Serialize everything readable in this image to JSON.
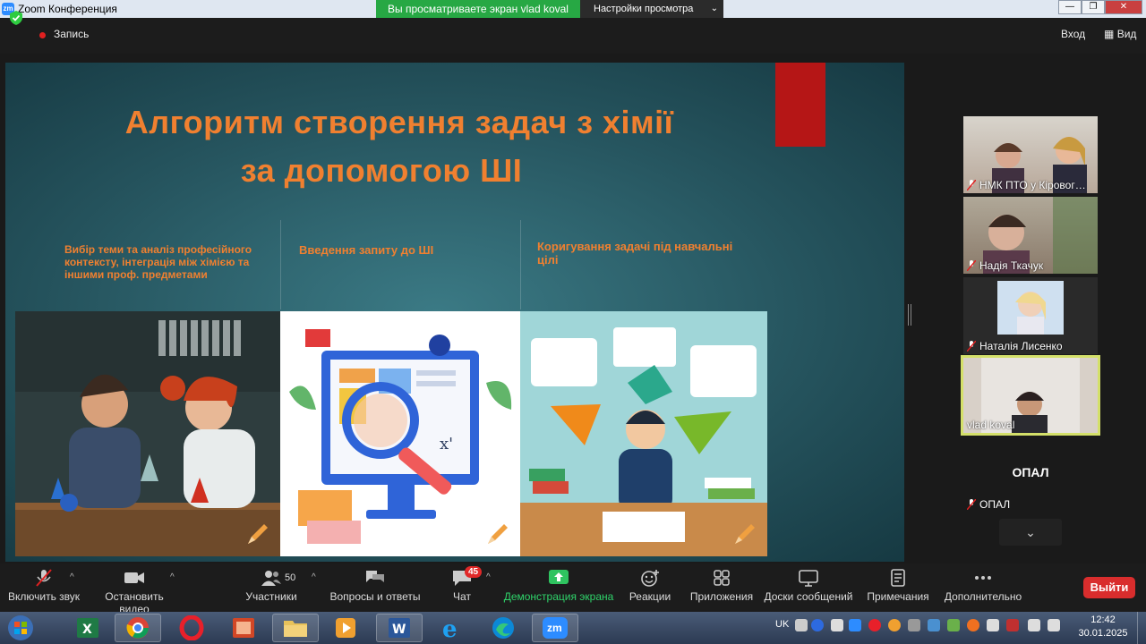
{
  "window": {
    "app_logo": "zm",
    "title": "Zoom Конференция",
    "share_banner": "Вы просматриваете экран vlad koval",
    "view_settings": "Настройки просмотра"
  },
  "status": {
    "recording_label": "Запись",
    "enter_label": "Вход",
    "view_label": "Вид"
  },
  "slide": {
    "title_line1": "Алгоритм створення задач з хімії",
    "title_line2": "за допомогою ШІ",
    "captions": [
      "Вибір теми та аналіз професійного контексту, інтеграція між хімією та іншими проф. предметами",
      "Введення запиту до ШІ",
      "Коригування задачі під навчальні цілі"
    ]
  },
  "gallery": {
    "participants": [
      {
        "name": "НМК ПТО у Кіровог…",
        "muted": true
      },
      {
        "name": "Надія Ткачук",
        "muted": true
      },
      {
        "name": "Наталія Лисенко",
        "muted": true
      },
      {
        "name": "vlad koval",
        "muted": false,
        "active": true
      },
      {
        "name": "ОПАЛ",
        "muted": true,
        "big_label": "ОПАЛ"
      }
    ],
    "scroll_icon": "chevron-down-icon"
  },
  "toolbar": {
    "unmute": "Включить звук",
    "stop_video": "Остановить видео",
    "participants": "Участники",
    "participants_count": "50",
    "qa": "Вопросы и ответы",
    "chat": "Чат",
    "chat_badge": "45",
    "share": "Демонстрация экрана",
    "reactions": "Реакции",
    "apps": "Приложения",
    "whiteboards": "Доски сообщений",
    "notes": "Примечания",
    "more": "Дополнительно",
    "leave": "Выйти"
  },
  "taskbar": {
    "apps": [
      "excel-icon",
      "chrome-icon",
      "opera-icon",
      "powerpoint-icon",
      "file-explorer-icon",
      "media-player-icon",
      "word-icon",
      "internet-explorer-icon",
      "edge-icon",
      "zoom-icon"
    ],
    "zoom_label": "zm",
    "language": "UK",
    "time": "12:42",
    "date": "30.01.2025"
  },
  "colors": {
    "accent_orange": "#f08030",
    "share_green": "#27a844",
    "leave_red": "#d92d2d",
    "active_speaker": "#d4e06a"
  }
}
